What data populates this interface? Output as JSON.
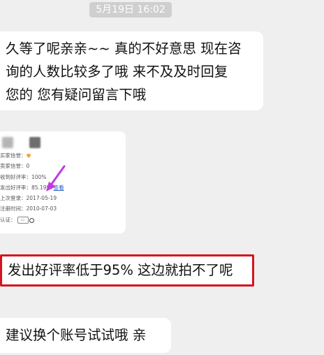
{
  "timestamp": "5月19日 16:02",
  "messages": {
    "m1": {
      "line1": "久等了呢亲亲~~ 真的不好意思 现在咨",
      "line2": "询的人数比较多了哦 来不及及时回复",
      "line3": "您的 您有疑问留言下哦"
    },
    "m3": "发出好评率低于95% 这边就拍不了呢",
    "m4": "建议换个账号试试哦 亲"
  },
  "profile_card": {
    "seller_credit_label": "买家信誉：",
    "buyer_credit_label": "卖家信誉：0",
    "received_rate": "收到好评率：100%",
    "sent_rate_label": "发出好评率：85.19%",
    "view_link": "查看",
    "last_login": "上次登录：2017-05-19",
    "register_time": "注册时间：2010-07-03",
    "verify_label": "认证：",
    "accent_arrow": "#c03adf",
    "highlight_border": "#d6121e"
  }
}
